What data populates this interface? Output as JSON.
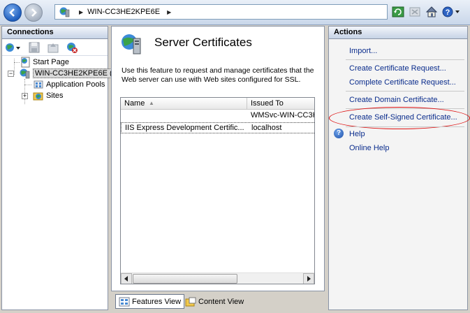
{
  "address_bar": {
    "crumbs": [
      "WIN-CC3HE2KPE6E"
    ]
  },
  "connections": {
    "title": "Connections",
    "tree": {
      "start_page": "Start Page",
      "server": "WIN-CC3HE2KPE6E (W",
      "app_pools": "Application Pools",
      "sites": "Sites"
    }
  },
  "content": {
    "title": "Server Certificates",
    "description": "Use this feature to request and manage certificates that the Web server can use with Web sites configured for SSL.",
    "columns": [
      "Name",
      "Issued To"
    ],
    "rows": [
      {
        "name": "",
        "issued_to": "WMSvc-WIN-CC3HE"
      },
      {
        "name": "IIS Express Development Certific...",
        "issued_to": "localhost"
      }
    ]
  },
  "view_tabs": {
    "features": "Features View",
    "content": "Content View"
  },
  "actions": {
    "title": "Actions",
    "import": "Import...",
    "create_request": "Create Certificate Request...",
    "complete_request": "Complete Certificate Request...",
    "create_domain": "Create Domain Certificate...",
    "create_self_signed": "Create Self-Signed Certificate...",
    "help": "Help",
    "online_help": "Online Help"
  },
  "colors": {
    "link": "#0a2c8c",
    "highlight": "#dd1111"
  }
}
